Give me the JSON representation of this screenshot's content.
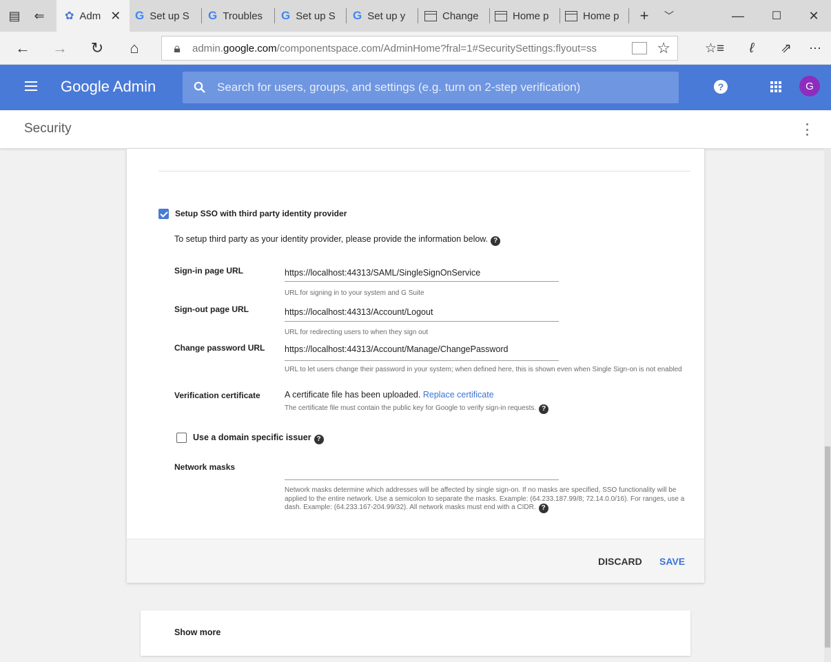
{
  "browser": {
    "tabs": [
      {
        "label": "Adm",
        "icon": "admin-icon",
        "active": true
      },
      {
        "label": "Set up S",
        "icon": "google-icon"
      },
      {
        "label": "Troubles",
        "icon": "google-icon"
      },
      {
        "label": "Set up S",
        "icon": "google-icon"
      },
      {
        "label": "Set up y",
        "icon": "google-icon"
      },
      {
        "label": "Change",
        "icon": "page-icon"
      },
      {
        "label": "Home p",
        "icon": "page-icon"
      },
      {
        "label": "Home p",
        "icon": "page-icon"
      }
    ],
    "url_prefix": "admin.",
    "url_domain": "google.com",
    "url_rest": "/componentspace.com/AdminHome?fral=1#SecuritySettings:flyout=ss"
  },
  "header": {
    "brand": "Google Admin",
    "search_placeholder": "Search for users, groups, and settings (e.g. turn on 2-step verification)",
    "avatar_letter": "G",
    "accent_color": "#4a7ad7"
  },
  "page": {
    "title": "Security"
  },
  "sso": {
    "setup_label": "Setup SSO with third party identity provider",
    "setup_checked": true,
    "intro": "To setup third party as your identity provider, please provide the information below.",
    "signin_label": "Sign-in page URL",
    "signin_value": "https://localhost:44313/SAML/SingleSignOnService",
    "signin_hint": "URL for signing in to your system and G Suite",
    "signout_label": "Sign-out page URL",
    "signout_value": "https://localhost:44313/Account/Logout",
    "signout_hint": "URL for redirecting users to when they sign out",
    "changepw_label": "Change password URL",
    "changepw_value": "https://localhost:44313/Account/Manage/ChangePassword",
    "changepw_hint": "URL to let users change their password in your system; when defined here, this is shown even when Single Sign-on is not enabled",
    "cert_label": "Verification certificate",
    "cert_text": "A certificate file has been uploaded.",
    "cert_link": "Replace certificate",
    "cert_hint": "The certificate file must contain the public key for Google to verify sign-in requests.",
    "domain_issuer_label": "Use a domain specific issuer",
    "domain_issuer_checked": false,
    "network_label": "Network masks",
    "network_value": "",
    "network_hint": "Network masks determine which addresses will be affected by single sign-on. If no masks are specified, SSO functionality will be applied to the entire network. Use a semicolon to separate the masks. Example: (64.233.187.99/8; 72.14.0.0/16). For ranges, use a dash. Example: (64.233.167-204.99/32). All network masks must end with a CIDR."
  },
  "actions": {
    "discard": "DISCARD",
    "save": "SAVE"
  },
  "showmore": {
    "label": "Show more"
  }
}
